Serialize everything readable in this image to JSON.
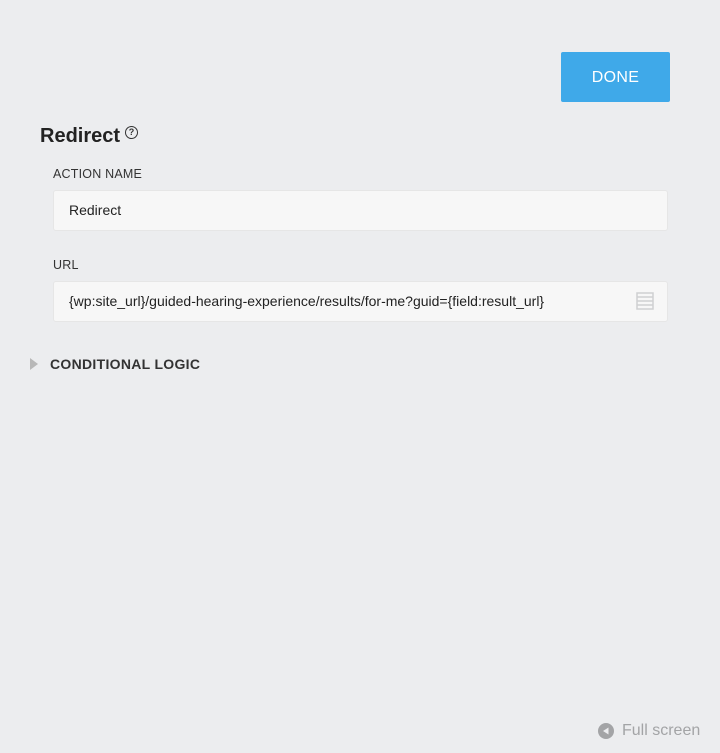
{
  "header": {
    "done_label": "DONE"
  },
  "section": {
    "title": "Redirect",
    "help_icon": "question-circle-icon"
  },
  "fields": {
    "action_name": {
      "label": "ACTION NAME",
      "value": "Redirect"
    },
    "url": {
      "label": "URL",
      "value": "{wp:site_url}/guided-hearing-experience/results/for-me?guid={field:result_url}",
      "icon": "merge-tags-icon"
    }
  },
  "conditional_logic": {
    "label": "CONDITIONAL LOGIC",
    "icon": "triangle-right-icon"
  },
  "footer": {
    "fullscreen_label": "Full screen",
    "fullscreen_icon": "play-back-circle-icon"
  },
  "colors": {
    "background": "#ecedef",
    "accent": "#3fa9e9",
    "input_bg": "#f7f7f7"
  }
}
